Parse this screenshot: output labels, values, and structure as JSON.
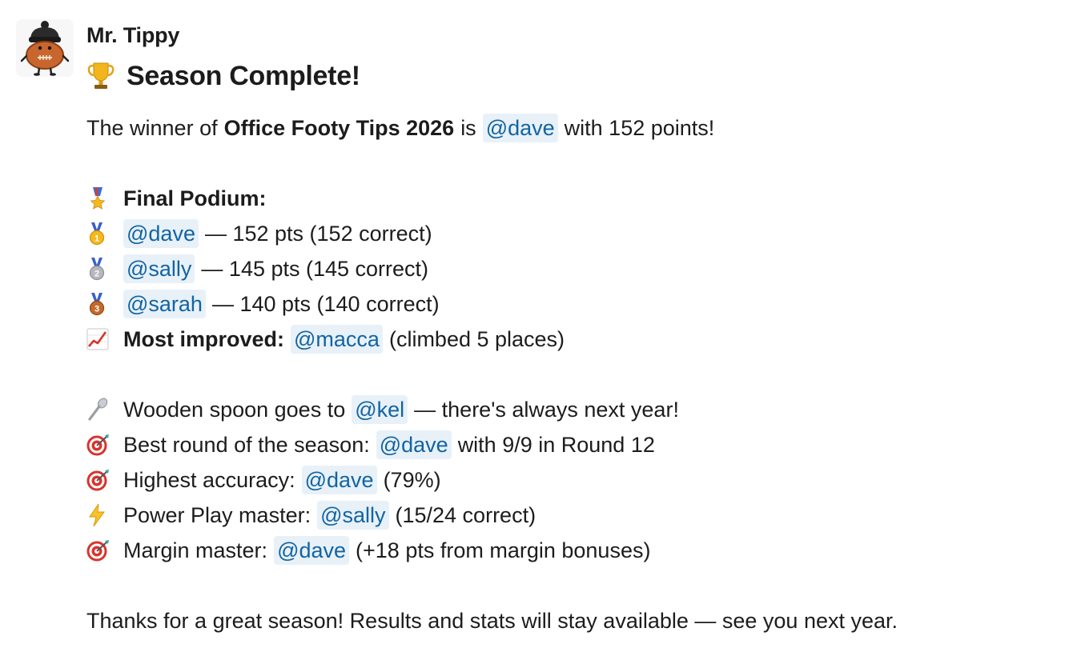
{
  "sender": {
    "name": "Mr. Tippy",
    "avatar_icon": "football-mascot-avatar"
  },
  "header": {
    "icon": "trophy-icon",
    "title": "Season Complete!"
  },
  "intro": {
    "prefix": "The winner of",
    "comp_name": "Office Footy Tips 2026",
    "is": "is",
    "winner_mention": "@dave",
    "suffix": "with 152 points!"
  },
  "podium": {
    "icon": "military-medal-icon",
    "title": "Final Podium:",
    "places": [
      {
        "icon": "gold-medal-icon",
        "mention": "@dave",
        "text": "— 152 pts (152 correct)"
      },
      {
        "icon": "silver-medal-icon",
        "mention": "@sally",
        "text": "— 145 pts (145 correct)"
      },
      {
        "icon": "bronze-medal-icon",
        "mention": "@sarah",
        "text": "— 140 pts (140 correct)"
      }
    ]
  },
  "most_improved": {
    "icon": "chart-increasing-icon",
    "label": "Most improved:",
    "mention": "@macca",
    "text": "(climbed 5 places)"
  },
  "awards": [
    {
      "icon": "spoon-icon",
      "prefix": "Wooden spoon goes to",
      "mention": "@kel",
      "suffix": "— there's always next year!"
    },
    {
      "icon": "target-icon",
      "prefix": "Best round of the season:",
      "mention": "@dave",
      "suffix": "with 9/9 in Round 12"
    },
    {
      "icon": "target-icon",
      "prefix": "Highest accuracy:",
      "mention": "@dave",
      "suffix": "(79%)"
    },
    {
      "icon": "lightning-icon",
      "prefix": "Power Play master:",
      "mention": "@sally",
      "suffix": "(15/24 correct)"
    },
    {
      "icon": "target-icon",
      "prefix": "Margin master:",
      "mention": "@dave",
      "suffix": "(+18 pts from margin bonuses)"
    }
  ],
  "closing": "Thanks for a great season! Results and stats will stay available — see you next year.",
  "colors": {
    "mention_bg": "#e8f1f8",
    "mention_text": "#1264a3",
    "text": "#1d1c1d"
  }
}
